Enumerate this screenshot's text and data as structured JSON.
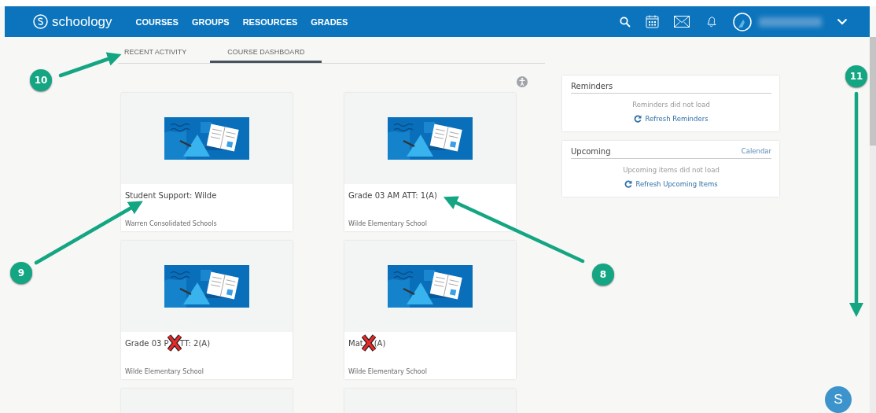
{
  "header": {
    "logo": "schoology",
    "nav": [
      {
        "label": "COURSES"
      },
      {
        "label": "GROUPS"
      },
      {
        "label": "RESOURCES"
      },
      {
        "label": "GRADES"
      }
    ]
  },
  "tabs": [
    {
      "label": "RECENT ACTIVITY",
      "selected": false
    },
    {
      "label": "COURSE DASHBOARD",
      "selected": true
    }
  ],
  "courses": [
    {
      "kind": "course",
      "title": "Student Support: Wilde",
      "school": "Warren Consolidated Schools"
    },
    {
      "kind": "course",
      "title": "Grade 03 AM ATT: 1(A)",
      "school": "Wilde Elementary School"
    },
    {
      "kind": "course",
      "title": "Grade 03 P",
      "title_after_mark": "TT: 2(A)",
      "school": "Wilde Elementary School"
    },
    {
      "kind": "course",
      "title": "Mat",
      "title_after_mark": "(A)",
      "school": "Wilde Elementary School"
    },
    {
      "kind": "partial"
    },
    {
      "kind": "partial"
    }
  ],
  "reminders": {
    "title": "Reminders",
    "message": "Reminders did not load",
    "action": "Refresh Reminders"
  },
  "upcoming": {
    "title": "Upcoming",
    "link": "Calendar",
    "message": "Upcoming items did not load",
    "action": "Refresh Upcoming Items"
  },
  "chat_button": {
    "label": "S"
  },
  "annotations": [
    {
      "label": "10"
    },
    {
      "label": "9"
    },
    {
      "label": "8"
    },
    {
      "label": "11"
    }
  ]
}
